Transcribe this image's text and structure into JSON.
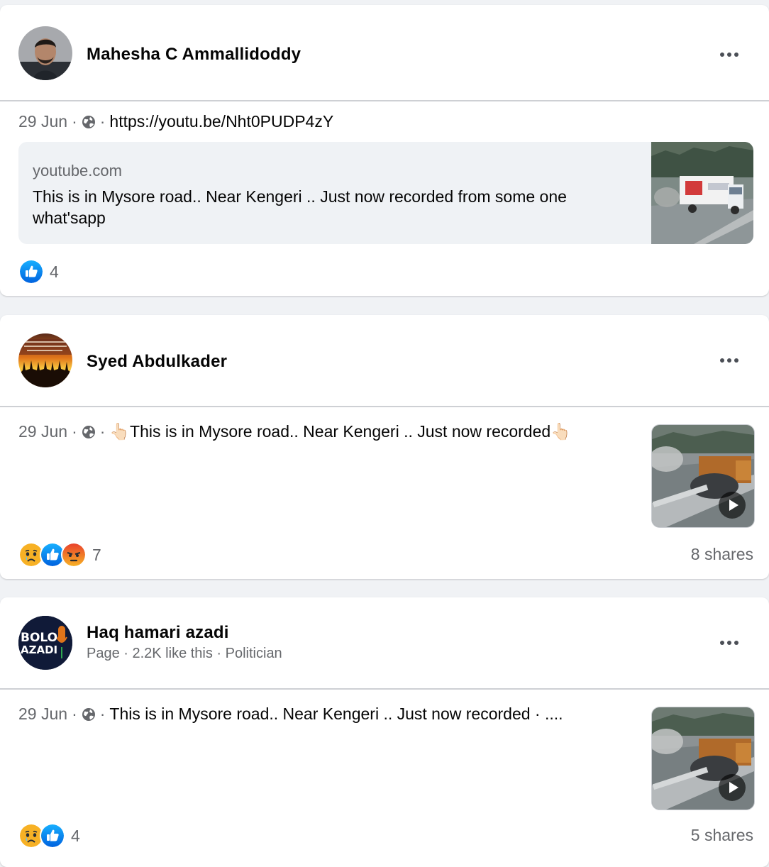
{
  "posts": [
    {
      "author": "Mahesha C Ammallidoddy",
      "author_meta": "",
      "date": "29 Jun",
      "privacy_icon": "globe-icon",
      "text": "https://youtu.be/Nht0PUDP4zY",
      "link_preview": {
        "domain": "youtube.com",
        "title": "This is in Mysore road.. Near Kengeri .. Just now recorded from some one what'sapp"
      },
      "reactions": [
        "like"
      ],
      "reaction_count": "4",
      "shares": ""
    },
    {
      "author": "Syed Abdulkader",
      "author_meta": "",
      "date": "29 Jun",
      "privacy_icon": "globe-icon",
      "text": "👆🏻This is in Mysore road.. Near Kengeri .. Just now recorded👆🏻",
      "reactions": [
        "sad",
        "like",
        "angry"
      ],
      "reaction_count": "7",
      "shares": "8 shares"
    },
    {
      "author": "Haq hamari azadi",
      "author_meta": "Page · 2.2K like this · Politician",
      "avatar_text": [
        "BOLO",
        "AZADI"
      ],
      "date": "29 Jun",
      "privacy_icon": "globe-icon",
      "text": "This is in Mysore road.. Near Kengeri .. Just now recorded · ....",
      "reactions": [
        "sad",
        "like"
      ],
      "reaction_count": "4",
      "shares": "5 shares"
    }
  ],
  "colors": {
    "background": "#f0f2f5",
    "secondary_text": "#65676b",
    "like_blue": "#1877f2",
    "angry_orange": "#e9710f",
    "sad_yellow": "#f7b125"
  }
}
